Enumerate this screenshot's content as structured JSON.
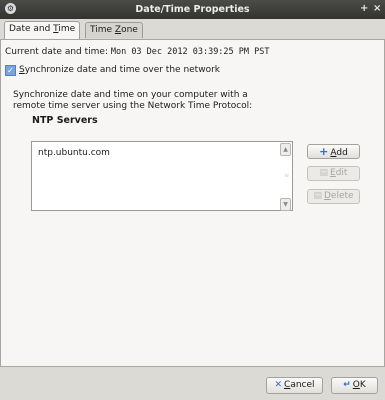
{
  "window": {
    "title": "Date/Time Properties",
    "menu_glyph": "⚙",
    "pin_glyph": "+",
    "close_glyph": "×"
  },
  "tabs": [
    {
      "label": "Date and ",
      "mnemonic": "T",
      "label_rest": "ime"
    },
    {
      "label": "Time ",
      "mnemonic": "Z",
      "label_rest": "one"
    }
  ],
  "main": {
    "current_label": "Current date and time: ",
    "current_value": "Mon 03 Dec 2012 03:39:25 PM PST",
    "sync": {
      "checked": true,
      "label_pre": "",
      "mnemonic": "S",
      "label_rest": "ynchronize date and time over the network"
    },
    "description_line1": "Synchronize date and time on your computer with a",
    "description_line2": "remote time server using the Network Time Protocol:",
    "ntp_heading": "NTP Servers",
    "servers": [
      "ntp.ubuntu.com"
    ],
    "buttons": {
      "add": {
        "mnemonic": "A",
        "rest": "dd"
      },
      "edit": {
        "mnemonic": "E",
        "rest": "dit"
      },
      "delete": {
        "mnemonic": "D",
        "rest": "elete"
      }
    }
  },
  "footer": {
    "cancel": {
      "mnemonic": "C",
      "rest": "ancel"
    },
    "ok": {
      "mnemonic": "O",
      "rest": "K"
    }
  }
}
